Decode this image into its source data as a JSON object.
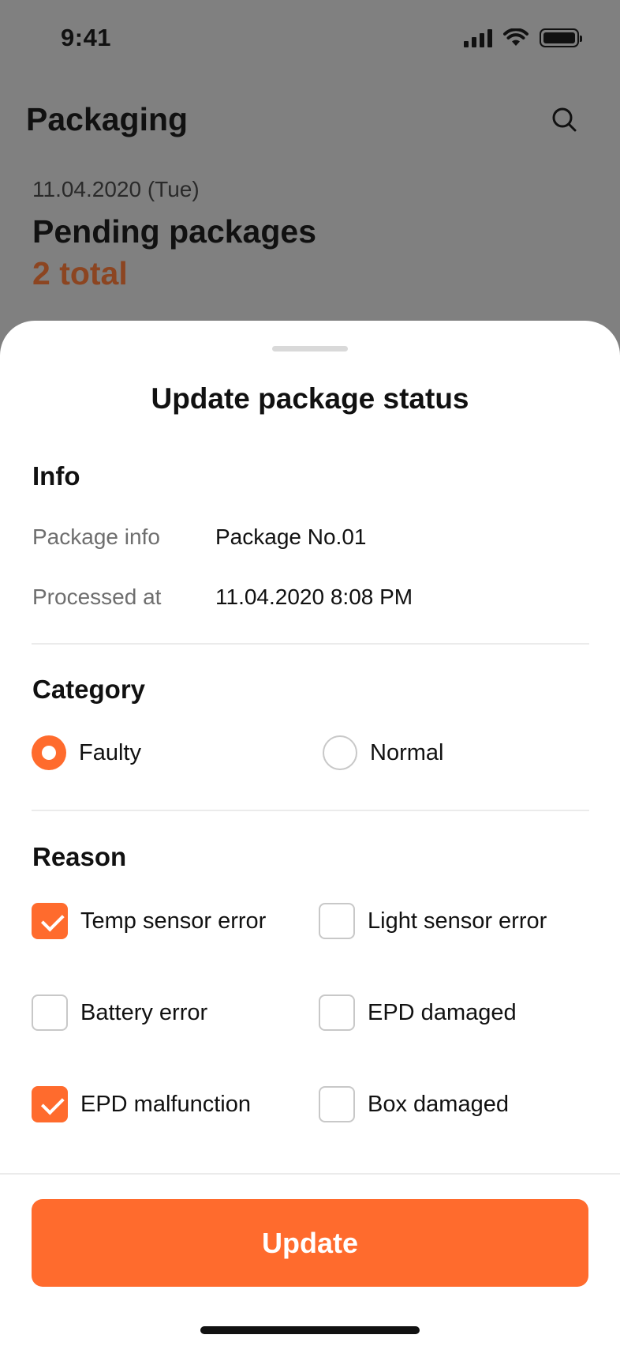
{
  "status_bar": {
    "time": "9:41"
  },
  "header": {
    "title": "Packaging",
    "search_icon": "search-icon"
  },
  "background": {
    "date": "11.04.2020 (Tue)",
    "heading": "Pending packages",
    "total": "2 total"
  },
  "sheet": {
    "title": "Update package status",
    "info": {
      "title": "Info",
      "rows": [
        {
          "label": "Package info",
          "value": "Package No.01"
        },
        {
          "label": "Processed at",
          "value": "11.04.2020 8:08 PM"
        }
      ]
    },
    "category": {
      "title": "Category",
      "options": [
        {
          "label": "Faulty",
          "selected": true
        },
        {
          "label": "Normal",
          "selected": false
        }
      ]
    },
    "reason": {
      "title": "Reason",
      "options": [
        {
          "label": "Temp sensor error",
          "checked": true
        },
        {
          "label": "Light sensor error",
          "checked": false
        },
        {
          "label": "Battery error",
          "checked": false
        },
        {
          "label": "EPD damaged",
          "checked": false
        },
        {
          "label": "EPD malfunction",
          "checked": true
        },
        {
          "label": "Box damaged",
          "checked": false
        }
      ]
    },
    "update_label": "Update"
  },
  "colors": {
    "accent": "#ff6b2d",
    "total_text": "#8c4521",
    "overlay_bg": "#808080",
    "unchecked_border": "#c8c8c8"
  }
}
